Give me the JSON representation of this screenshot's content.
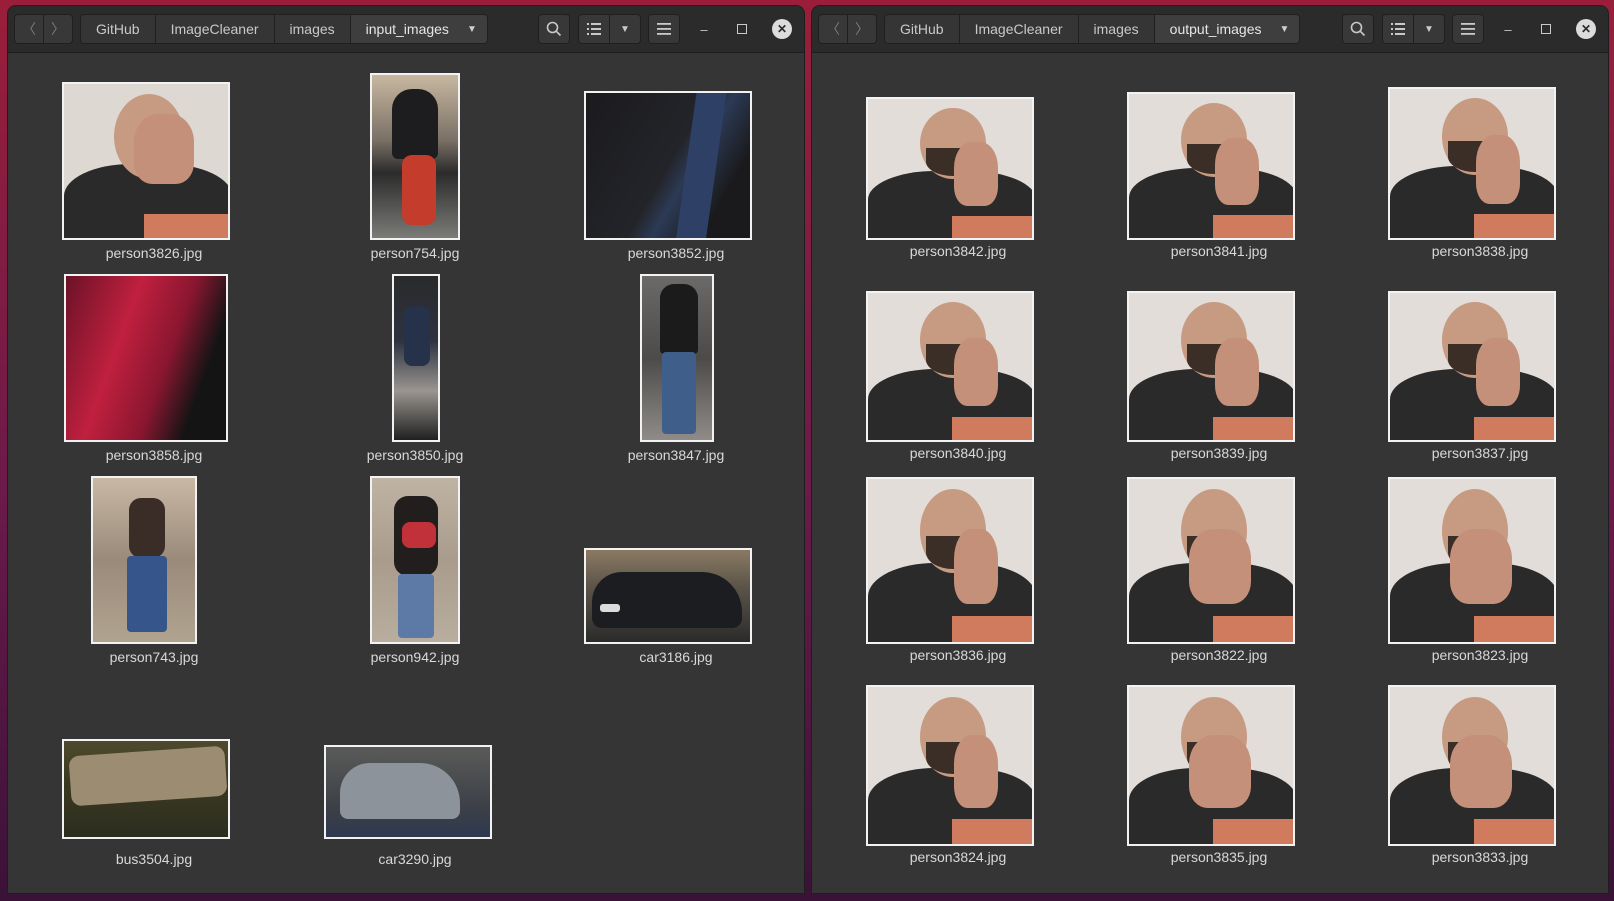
{
  "windows": [
    {
      "breadcrumbs": [
        "GitHub",
        "ImageCleaner",
        "images",
        "input_images"
      ],
      "files": [
        {
          "name": "person3826.jpg",
          "kind": "face"
        },
        {
          "name": "person754.jpg",
          "kind": "cyclist"
        },
        {
          "name": "person3852.jpg",
          "kind": "dark"
        },
        {
          "name": "person3858.jpg",
          "kind": "red-blur"
        },
        {
          "name": "person3850.jpg",
          "kind": "walker"
        },
        {
          "name": "person3847.jpg",
          "kind": "walker"
        },
        {
          "name": "person743.jpg",
          "kind": "street"
        },
        {
          "name": "person942.jpg",
          "kind": "bag"
        },
        {
          "name": "car3186.jpg",
          "kind": "car"
        },
        {
          "name": "bus3504.jpg",
          "kind": "bus"
        },
        {
          "name": "car3290.jpg",
          "kind": "car2"
        }
      ]
    },
    {
      "breadcrumbs": [
        "GitHub",
        "ImageCleaner",
        "images",
        "output_images"
      ],
      "files": [
        {
          "name": "person3842.jpg",
          "kind": "face"
        },
        {
          "name": "person3841.jpg",
          "kind": "face"
        },
        {
          "name": "person3838.jpg",
          "kind": "face"
        },
        {
          "name": "person3840.jpg",
          "kind": "face"
        },
        {
          "name": "person3839.jpg",
          "kind": "face"
        },
        {
          "name": "person3837.jpg",
          "kind": "face"
        },
        {
          "name": "person3836.jpg",
          "kind": "face"
        },
        {
          "name": "person3822.jpg",
          "kind": "face"
        },
        {
          "name": "person3823.jpg",
          "kind": "face"
        },
        {
          "name": "person3824.jpg",
          "kind": "face"
        },
        {
          "name": "person3835.jpg",
          "kind": "face"
        },
        {
          "name": "person3833.jpg",
          "kind": "face"
        }
      ]
    }
  ],
  "icons": {
    "back": "chevron-left-icon",
    "forward": "chevron-right-icon",
    "search": "search-icon",
    "list_view": "list-view-icon",
    "view_options": "chevron-down-icon",
    "menu": "hamburger-menu-icon",
    "minimize": "minimize-icon",
    "maximize": "maximize-icon",
    "close": "close-icon"
  }
}
